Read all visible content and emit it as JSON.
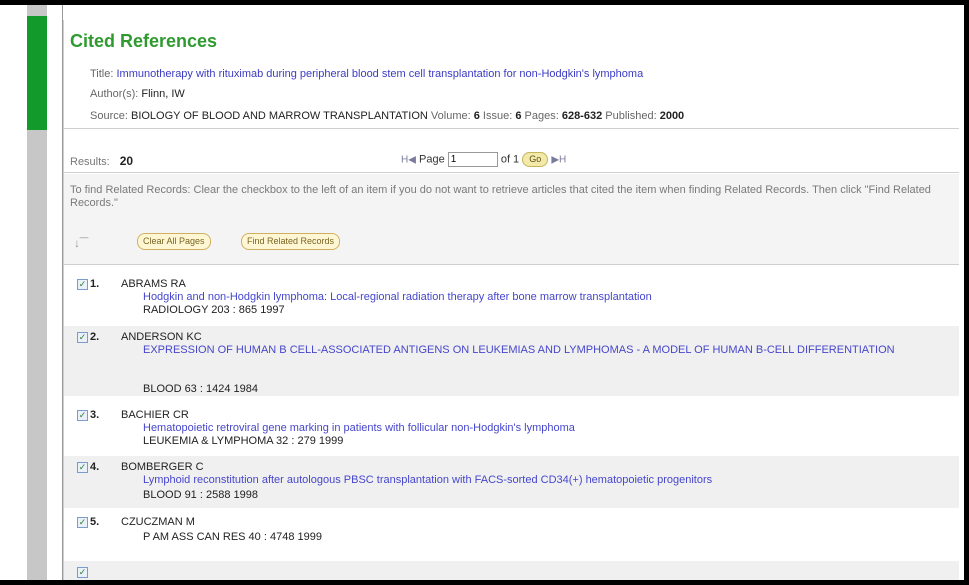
{
  "header": {
    "title": "Cited References",
    "title_label": "Title:",
    "title_value": "Immunotherapy with rituximab during peripheral blood stem cell transplantation for non-Hodgkin's lymphoma",
    "author_label": "Author(s):",
    "author_value": "Flinn, IW",
    "source_label": "Source:",
    "source_value": "BIOLOGY OF BLOOD AND MARROW TRANSPLANTATION",
    "volume_label": "Volume:",
    "volume_value": "6",
    "issue_label": "Issue:",
    "issue_value": "6",
    "pages_label": "Pages:",
    "pages_value": "628-632",
    "published_label": "Published:",
    "published_value": "2000"
  },
  "results": {
    "label": "Results:",
    "count": "20"
  },
  "pager": {
    "first": "H",
    "prev": "◀",
    "page_label": "Page",
    "page_value": "1",
    "of_label": "of 1",
    "go_label": "Go",
    "next": "▶",
    "last": "H"
  },
  "instructions": "To find Related Records: Clear the checkbox to the left of an item if you do not want to retrieve articles that cited the item when finding Related Records. Then click \"Find Related Records.\"",
  "buttons": {
    "clear_all": "Clear All Pages",
    "find_related": "Find Related Records"
  },
  "references": [
    {
      "num": "1.",
      "author": "ABRAMS RA",
      "title": "Hodgkin and non-Hodgkin lymphoma: Local-regional radiation therapy after bone marrow transplantation",
      "source": "RADIOLOGY 203 : 865 1997",
      "checked": true
    },
    {
      "num": "2.",
      "author": "ANDERSON KC",
      "title": "EXPRESSION OF HUMAN B CELL-ASSOCIATED ANTIGENS ON LEUKEMIAS AND LYMPHOMAS - A MODEL OF HUMAN B-CELL DIFFERENTIATION",
      "source": "BLOOD 63 : 1424 1984",
      "checked": true
    },
    {
      "num": "3.",
      "author": "BACHIER CR",
      "title": "Hematopoietic retroviral gene marking in patients with follicular non-Hodgkin's lymphoma",
      "source": "LEUKEMIA & LYMPHOMA 32 : 279 1999",
      "checked": true
    },
    {
      "num": "4.",
      "author": "BOMBERGER C",
      "title": "Lymphoid reconstitution after autologous PBSC transplantation with FACS-sorted CD34(+) hematopoietic progenitors",
      "source": "BLOOD 91 : 2588 1998",
      "checked": true
    },
    {
      "num": "5.",
      "author": "CZUCZMAN M",
      "title": "",
      "source": "P AM ASS CAN RES 40 : 4748 1999",
      "checked": true
    }
  ],
  "colors": {
    "accent_green": "#129a2a",
    "title_green": "#2f9a2f",
    "link_blue": "#4646cc"
  }
}
